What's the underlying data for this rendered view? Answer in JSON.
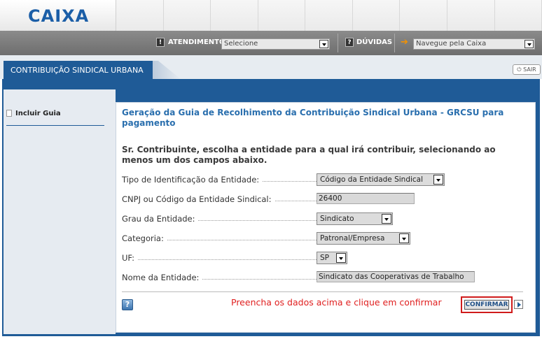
{
  "header": {
    "logo_text": "CAIXA"
  },
  "nav": {
    "atendimento_label": "ATENDIMENTO",
    "atendimento_select": "Selecione",
    "duvidas_label": "DÚVIDAS",
    "navegue_select": "Navegue pela Caixa"
  },
  "tab": {
    "label": "CONTRIBUIÇÃO SINDICAL URBANA",
    "sair": "SAIR"
  },
  "sidebar": {
    "items": [
      {
        "label": "Incluir Guia"
      }
    ]
  },
  "form": {
    "title": "Geração da Guia de Recolhimento da Contribuição Sindical Urbana - GRCSU para pagamento",
    "instructions": "Sr. Contribuinte, escolha a entidade para a qual irá contribuir, selecionando ao menos um dos campos abaixo.",
    "fields": [
      {
        "label": "Tipo de Identificação da Entidade:",
        "value": "Código da Entidade Sindical",
        "type": "select"
      },
      {
        "label": "CNPJ ou Código da Entidade Sindical:",
        "value": "26400",
        "type": "input"
      },
      {
        "label": "Grau da Entidade:",
        "value": "Sindicato",
        "type": "select"
      },
      {
        "label": "Categoria:",
        "value": "Patronal/Empresa",
        "type": "select"
      },
      {
        "label": "UF:",
        "value": "SP",
        "type": "select"
      },
      {
        "label": "Nome da Entidade:",
        "value": "Sindicato das Cooperativas de Trabalho",
        "type": "input"
      }
    ],
    "help_label": "?",
    "annotation": "Preencha os dados acima e clique em confirmar",
    "confirm_label": "CONFIRMAR"
  },
  "colors": {
    "brand_blue": "#1f5b97",
    "brand_orange": "#f39200",
    "annotation_red": "#e02020"
  }
}
